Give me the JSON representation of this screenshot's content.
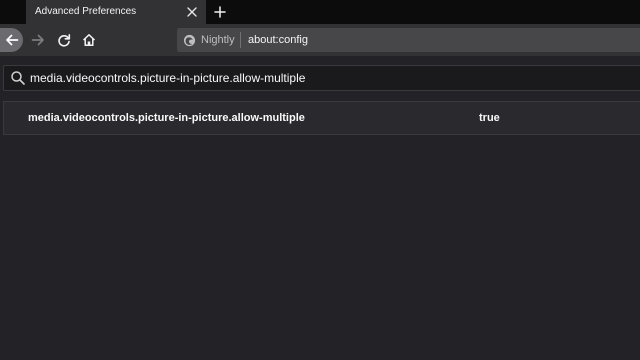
{
  "tabs": [
    {
      "title": "Advanced Preferences",
      "close_icon": "close-icon"
    }
  ],
  "toolbar": {
    "back_icon": "arrow-left-icon",
    "forward_icon": "arrow-right-icon",
    "reload_icon": "reload-icon",
    "home_icon": "home-icon",
    "new_tab_icon": "plus-icon"
  },
  "urlbar": {
    "identity_label": "Nightly",
    "url": "about:config"
  },
  "search": {
    "value": "media.videocontrols.picture-in-picture.allow-multiple"
  },
  "preferences": [
    {
      "name": "media.videocontrols.picture-in-picture.allow-multiple",
      "value": "true"
    }
  ],
  "colors": {
    "tabstrip_bg": "#0c0c0d",
    "toolbar_bg": "#323234",
    "page_bg": "#232327",
    "text": "#f9f9fa"
  }
}
